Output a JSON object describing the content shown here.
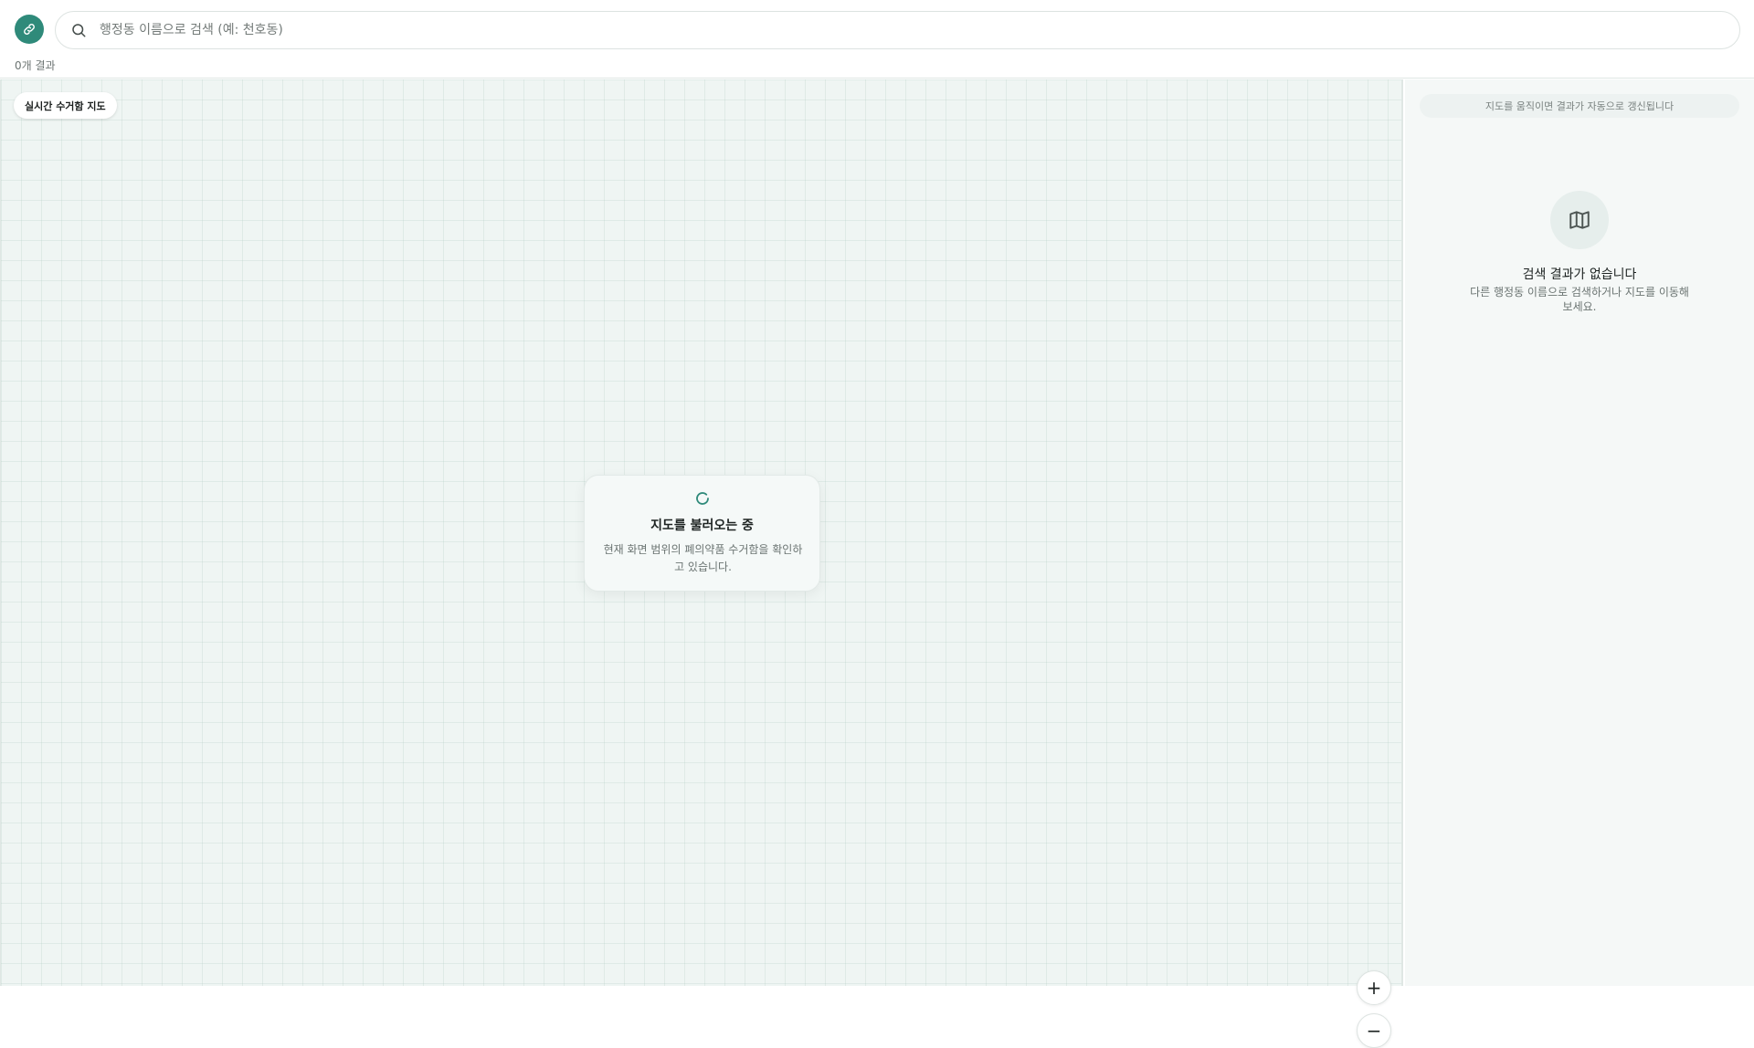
{
  "header": {
    "logo_icon": "link-icon",
    "search": {
      "icon": "search-icon",
      "placeholder": "행정동 이름으로 검색 (예: 천호동)",
      "value": ""
    },
    "result_count": "0개 결과"
  },
  "map": {
    "badge": "실시간 수거함 지도",
    "loading": {
      "icon": "spinner-icon",
      "title": "지도를 불러오는 중",
      "description": "현재 화면 범위의 폐의약품 수거함을 확인하고 있습니다."
    },
    "zoom_in_label": "+",
    "zoom_out_label": "−"
  },
  "panel": {
    "notice": "지도를 움직이면 결과가 자동으로 갱신됩니다",
    "empty_icon": "map-icon",
    "empty_title": "검색 결과가 없습니다",
    "empty_description": "다른 행정동 이름으로 검색하거나 지도를 이동해 보세요."
  },
  "colors": {
    "accent": "#2f8a7a",
    "map_background": "#eff5f3",
    "panel_background": "#f5f8f7"
  }
}
